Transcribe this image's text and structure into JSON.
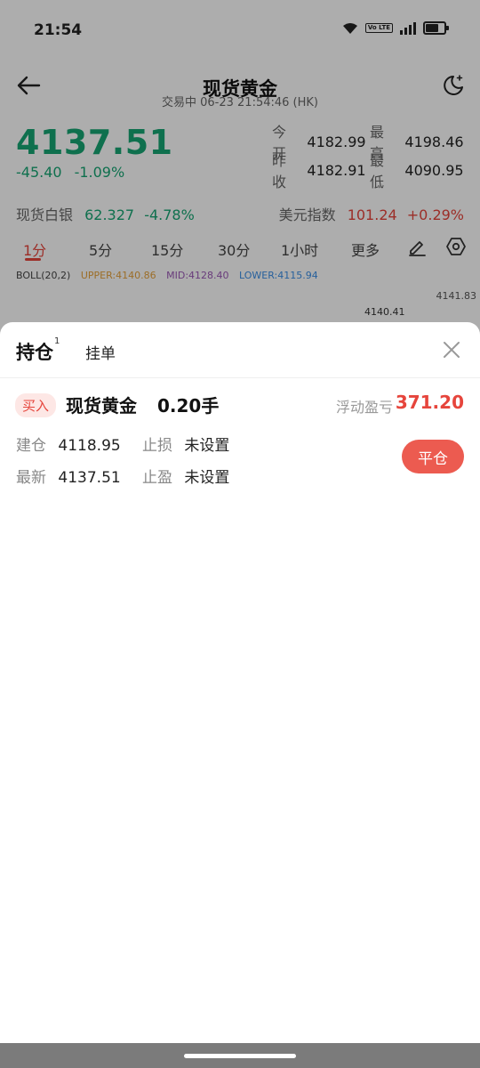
{
  "status_bar": {
    "time": "21:54",
    "volte": "Vo LTE"
  },
  "header": {
    "title": "现货黄金",
    "subtitle": "交易中  06-23 21:54:46 (HK)"
  },
  "quote": {
    "price": "4137.51",
    "change": "-45.40",
    "change_pct": "-1.09%",
    "open_label": "今开",
    "open": "4182.99",
    "high_label": "最高",
    "high": "4198.46",
    "prev_close_label": "昨收",
    "prev_close": "4182.91",
    "low_label": "最低",
    "low": "4090.95"
  },
  "related": {
    "silver_label": "现货白银",
    "silver_value": "62.327",
    "silver_change": "-4.78%",
    "usd_label": "美元指数",
    "usd_value": "101.24",
    "usd_change": "+0.29%"
  },
  "timeframes": [
    "1分",
    "5分",
    "15分",
    "30分",
    "1小时",
    "更多"
  ],
  "indicator": {
    "name": "BOLL(20,2)",
    "upper": "UPPER:4140.86",
    "mid": "MID:4128.40",
    "lower": "LOWER:4115.94",
    "axis_top": "4141.83",
    "last": "4140.41"
  },
  "sheet": {
    "tab_positions": "持仓",
    "tab_positions_count": "1",
    "tab_pending": "挂单",
    "position": {
      "side": "买入",
      "name": "现货黄金",
      "qty": "0.20手",
      "pl_label": "浮动盈亏",
      "pl_value": "371.20",
      "open_label": "建仓",
      "open_value": "4118.95",
      "sl_label": "止损",
      "sl_value": "未设置",
      "last_label": "最新",
      "last_value": "4137.51",
      "tp_label": "止盈",
      "tp_value": "未设置",
      "close_button": "平仓"
    }
  },
  "colors": {
    "up": "#e6453c",
    "down": "#17a673",
    "accent": "#ec5b50"
  },
  "icons": [
    "back-icon",
    "moon-icon",
    "wifi-icon",
    "signal-icon",
    "battery-icon",
    "edit-icon",
    "settings-hex-icon",
    "close-icon"
  ]
}
